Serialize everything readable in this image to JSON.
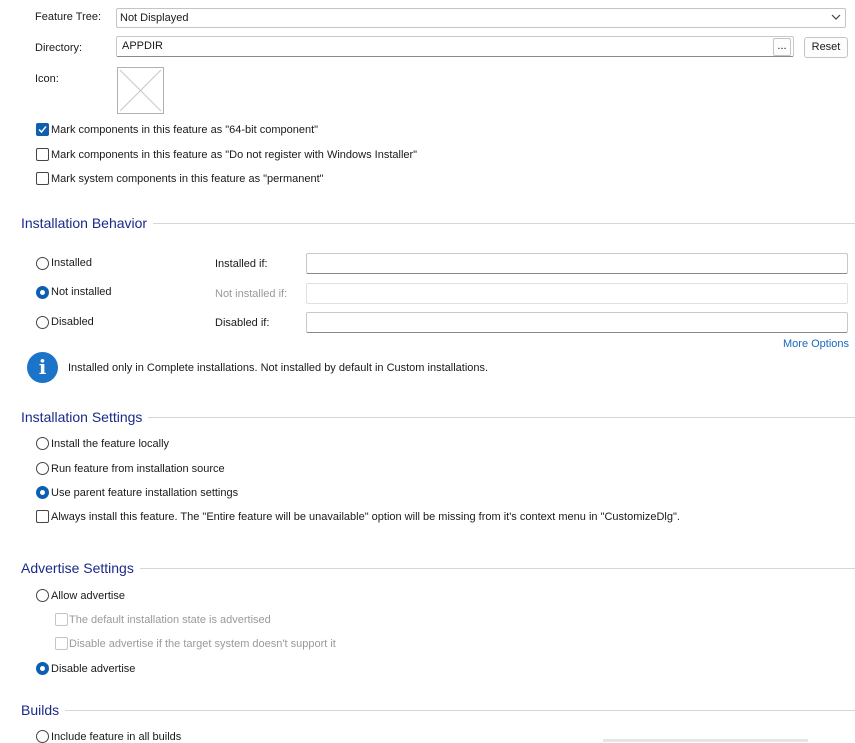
{
  "top": {
    "feature_tree_label": "Feature Tree:",
    "feature_tree_value": "Not Displayed",
    "directory_label": "Directory:",
    "directory_value": "APPDIR",
    "browse_label": "...",
    "reset_label": "Reset",
    "icon_label": "Icon:",
    "options": [
      {
        "label": "Mark components in this feature as \"64-bit component\"",
        "checked": true
      },
      {
        "label": "Mark components in this feature as \"Do not register with Windows Installer\"",
        "checked": false
      },
      {
        "label": "Mark system components in this feature as \"permanent\"",
        "checked": false
      }
    ]
  },
  "installation_behavior": {
    "title": "Installation Behavior",
    "radios": [
      {
        "label": "Installed",
        "checked": false
      },
      {
        "label": "Not installed",
        "checked": true
      },
      {
        "label": "Disabled",
        "checked": false
      }
    ],
    "conditions": [
      {
        "label": "Installed if:",
        "value": "",
        "enabled": true
      },
      {
        "label": "Not installed if:",
        "value": "",
        "enabled": false
      },
      {
        "label": "Disabled if:",
        "value": "",
        "enabled": true
      }
    ],
    "more_options": "More Options",
    "info_icon": "info-icon",
    "info_text": "Installed only in Complete installations. Not installed by default in Custom installations."
  },
  "installation_settings": {
    "title": "Installation Settings",
    "radios": [
      {
        "label": "Install the feature locally",
        "checked": false
      },
      {
        "label": "Run feature from installation source",
        "checked": false
      },
      {
        "label": "Use parent feature installation settings",
        "checked": true
      }
    ],
    "always_install": {
      "label": "Always install this feature. The \"Entire feature will be unavailable\" option will be missing from it's context menu in \"CustomizeDlg\".",
      "checked": false
    }
  },
  "advertise_settings": {
    "title": "Advertise Settings",
    "allow_label": "Allow advertise",
    "allow_checked": false,
    "sub_options": [
      {
        "label": "The default installation state is advertised",
        "checked": false,
        "enabled": false
      },
      {
        "label": "Disable advertise if the target system doesn't support it",
        "checked": false,
        "enabled": false
      }
    ],
    "disable_label": "Disable advertise",
    "disable_checked": true
  },
  "builds": {
    "title": "Builds",
    "include_all_label": "Include feature in all builds",
    "include_all_checked": false
  },
  "colors": {
    "accent": "#0f5fb0",
    "section_title": "#1a2a8a",
    "link": "#1a66c2",
    "info": "#1c74c9"
  }
}
